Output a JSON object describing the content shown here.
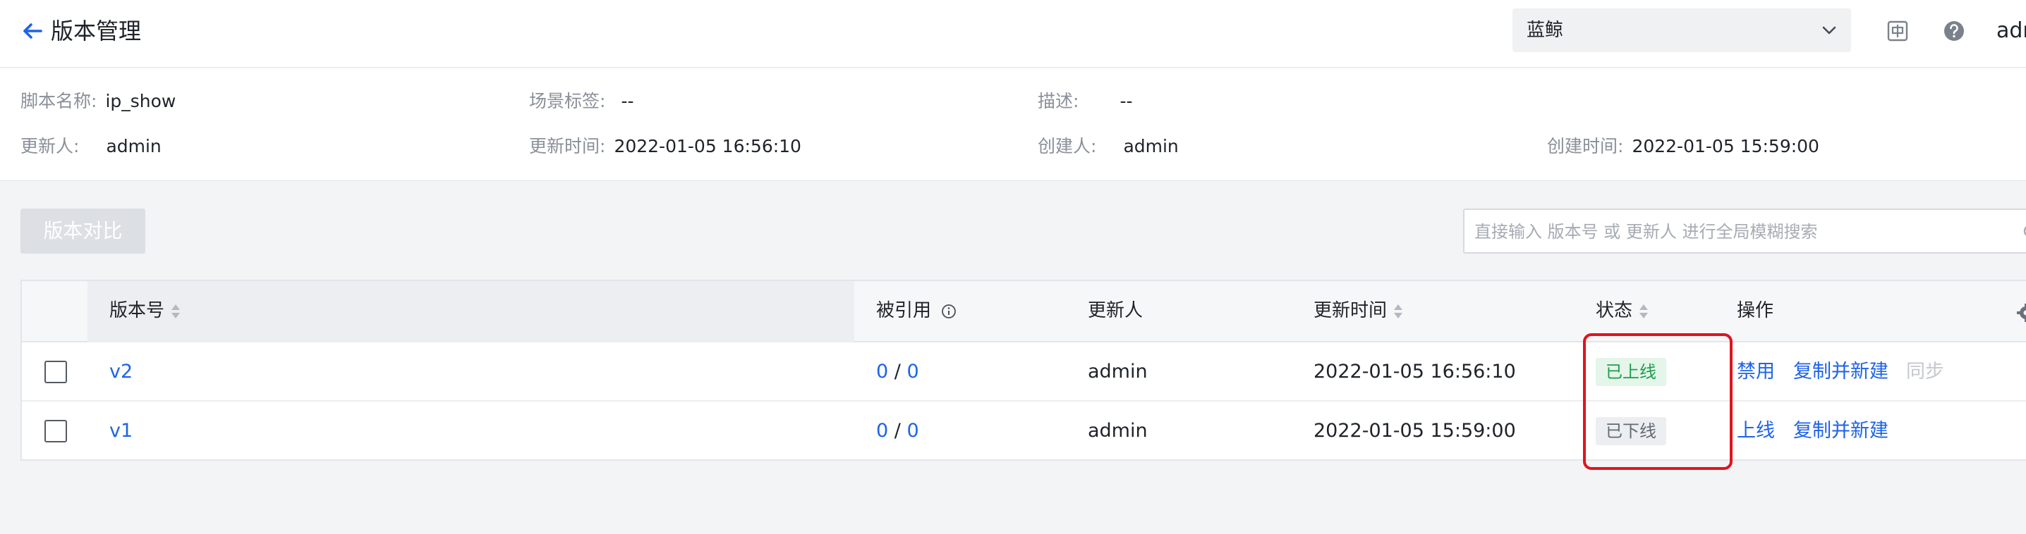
{
  "header": {
    "title": "版本管理",
    "project_select": "蓝鲸",
    "user": "admin"
  },
  "info": {
    "script_name_label": "脚本名称:",
    "script_name": "ip_show",
    "scene_tag_label": "场景标签:",
    "scene_tag": "--",
    "desc_label": "描述:",
    "desc": "--",
    "updater_label": "更新人:",
    "updater": "admin",
    "update_time_label": "更新时间:",
    "update_time": "2022-01-05 16:56:10",
    "creator_label": "创建人:",
    "creator": "admin",
    "create_time_label": "创建时间:",
    "create_time": "2022-01-05 15:59:00"
  },
  "toolbar": {
    "compare_button": "版本对比",
    "search_placeholder": "直接输入 版本号 或 更新人 进行全局模糊搜索"
  },
  "table": {
    "columns": {
      "version": "版本号",
      "referenced": "被引用",
      "updater": "更新人",
      "update_time": "更新时间",
      "status": "状态",
      "actions": "操作"
    },
    "rows": [
      {
        "version": "v2",
        "ref_a": "0",
        "ref_sep": "/",
        "ref_b": "0",
        "updater": "admin",
        "update_time": "2022-01-05 16:56:10",
        "status": "已上线",
        "action_1": "禁用",
        "action_2": "复制并新建",
        "action_3": "同步"
      },
      {
        "version": "v1",
        "ref_a": "0",
        "ref_sep": "/",
        "ref_b": "0",
        "updater": "admin",
        "update_time": "2022-01-05 15:59:00",
        "status": "已下线",
        "action_1": "上线",
        "action_2": "复制并新建"
      }
    ]
  },
  "colors": {
    "link": "#1e63e9",
    "online_badge_bg": "#e3f6e9",
    "online_badge_text": "#1f9c4e",
    "offline_badge_bg": "#eceef1",
    "highlight": "#e0141e"
  },
  "icons": {
    "back": "arrow-left-icon",
    "select": "chevron-down-icon",
    "header_1": "chinese-input-icon",
    "header_2": "help-icon",
    "search": "search-icon",
    "sort": "sort-icon",
    "info": "info-icon",
    "settings": "gear-icon"
  }
}
